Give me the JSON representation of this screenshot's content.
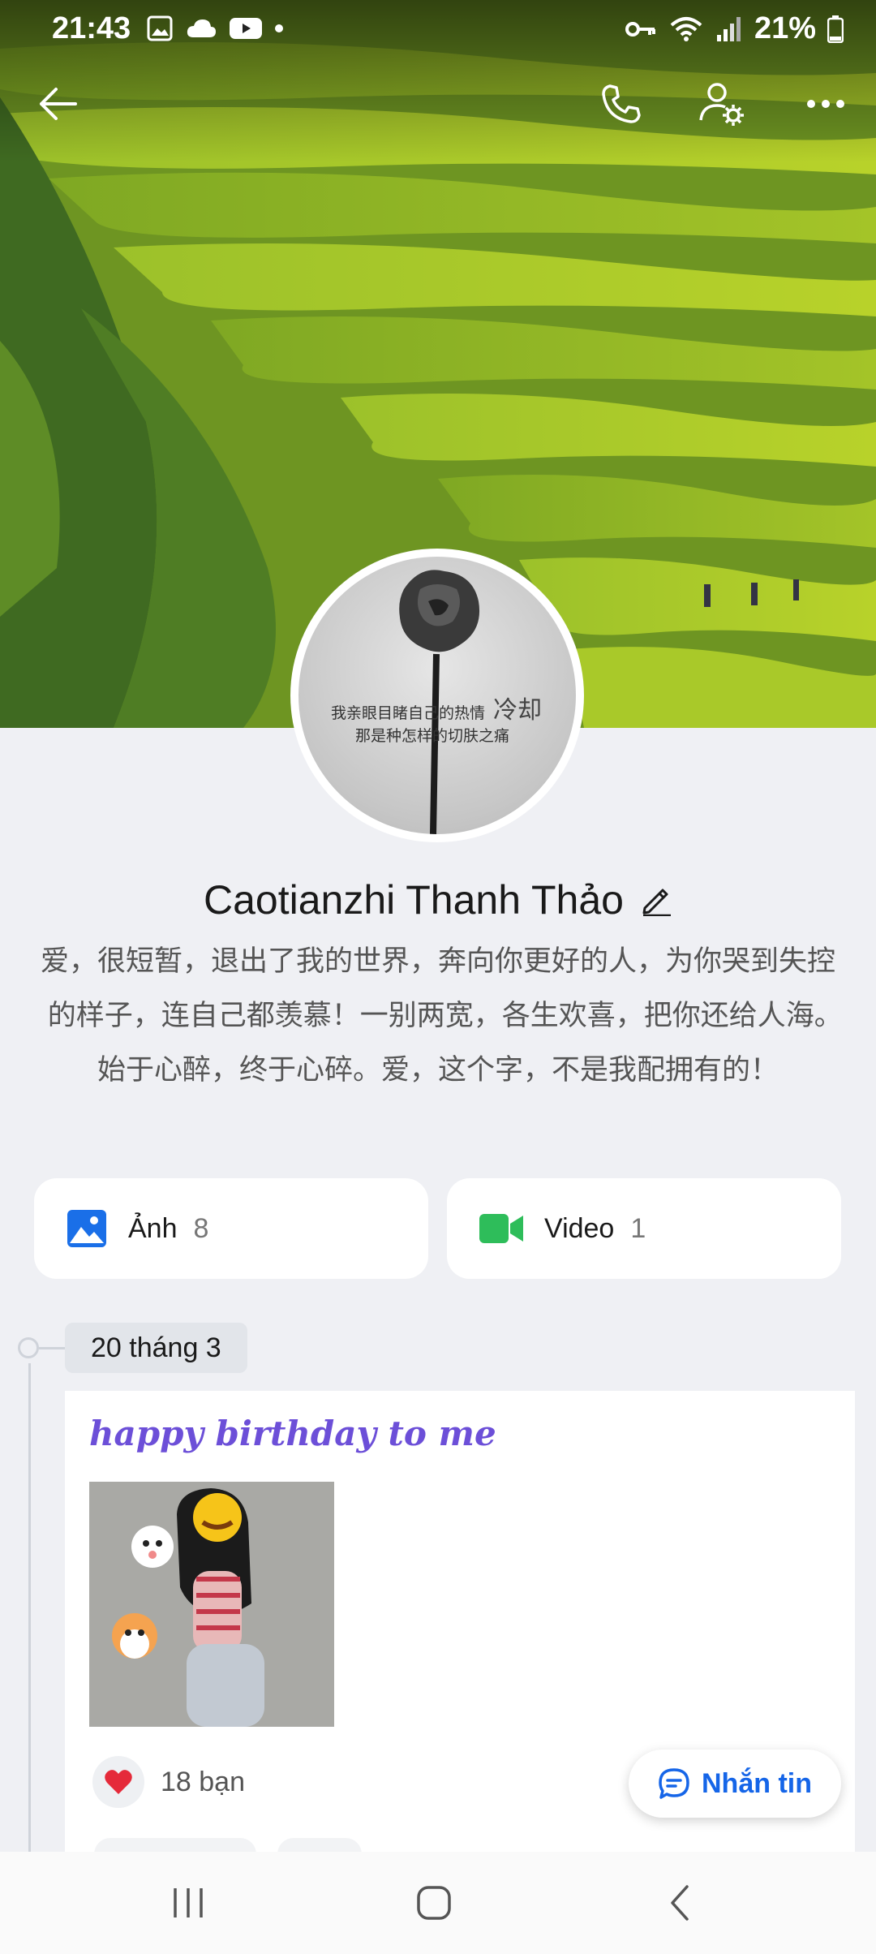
{
  "status_bar": {
    "time": "21:43",
    "battery": "21%"
  },
  "profile": {
    "name": "Caotianzhi Thanh Thảo",
    "bio": "爱，很短暂，退出了我的世界，奔向你更好的人，为你哭到失控的样子，连自己都羡慕！一别两宽，各生欢喜，把你还给人海。　　始于心醉，终于心碎。爱，这个字，不是我配拥有的！",
    "avatar_caption_line1": "我亲眼目睹自己的热情",
    "avatar_caption_line2": "那是种怎样的切肤之痛",
    "avatar_caption_title": "冷却"
  },
  "media": {
    "photos_label": "Ảnh",
    "photos_count": "8",
    "videos_label": "Video",
    "videos_count": "1"
  },
  "timeline": {
    "date": "20 tháng 3",
    "post_title": "happy birthday to me",
    "reaction_count": "18 bạn"
  },
  "message_button": {
    "label": "Nhắn tin"
  },
  "colors": {
    "accent_blue": "#1565e8",
    "photo_icon_blue": "#1a6fe8",
    "video_icon_green": "#2ebd5a",
    "post_title_purple": "#6c4fd8",
    "heart_red": "#e52a3a"
  },
  "icons": {
    "back": "arrow-left-icon",
    "call": "phone-icon",
    "profile_settings": "user-gear-icon",
    "more": "more-dots-icon",
    "edit_name": "pencil-icon",
    "photos": "image-icon",
    "videos": "video-camera-icon",
    "heart": "heart-icon",
    "message": "chat-bubble-icon"
  }
}
